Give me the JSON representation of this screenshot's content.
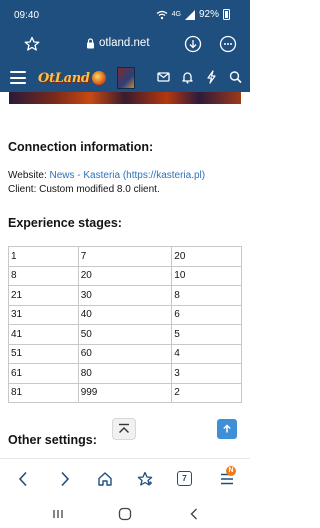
{
  "status_bar": {
    "time": "09:40",
    "network": "4G",
    "battery_percent": "92%"
  },
  "address_bar": {
    "url": "otland.net",
    "icons": [
      "star-icon",
      "lock-icon",
      "download-icon",
      "more-icon"
    ]
  },
  "site_nav": {
    "logo_text": "OtLand",
    "icons": [
      "hamburger-icon",
      "mail-icon",
      "bell-icon",
      "lightning-icon",
      "search-icon"
    ]
  },
  "content": {
    "connection_heading": "Connection information:",
    "website_label": "Website: ",
    "website_link": "News - Kasteria (https://kasteria.pl)",
    "client_line": "Client: Custom modified 8.0 client.",
    "experience_heading": "Experience stages:",
    "stages": [
      [
        "1",
        "7",
        "20"
      ],
      [
        "8",
        "20",
        "10"
      ],
      [
        "21",
        "30",
        "8"
      ],
      [
        "31",
        "40",
        "6"
      ],
      [
        "41",
        "50",
        "5"
      ],
      [
        "51",
        "60",
        "4"
      ],
      [
        "61",
        "80",
        "3"
      ],
      [
        "81",
        "999",
        "2"
      ]
    ],
    "other_heading": "Other settings:"
  },
  "bottom_toolbar": {
    "tab_count": "7",
    "menu_badge": "N",
    "icons": [
      "back-icon",
      "forward-icon",
      "home-icon",
      "bookmark-icon",
      "tabs-icon",
      "menu-icon"
    ]
  },
  "colors": {
    "header_blue": "#1f4f7e",
    "link_blue": "#2d72b8",
    "accent_button": "#3f8fd6",
    "badge_orange": "#f07a1a"
  }
}
